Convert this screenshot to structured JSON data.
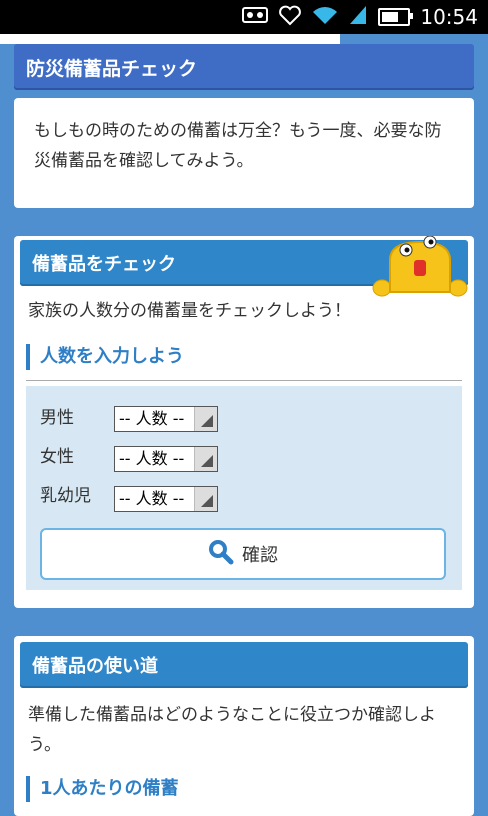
{
  "status_bar": {
    "time": "10:54"
  },
  "header_panel": {
    "title": "防災備蓄品チェック"
  },
  "intro_panel": {
    "text": "もしもの時のための備蓄は万全？もう一度、必要な防災備蓄品を確認してみよう。"
  },
  "check_panel": {
    "title": "備蓄品をチェック",
    "description": "家族の人数分の備蓄量をチェックしよう！",
    "subheading": "人数を入力しよう",
    "rows": [
      {
        "label": "男性",
        "selected": "-- 人数 --"
      },
      {
        "label": "女性",
        "selected": "-- 人数 --"
      },
      {
        "label": "乳幼児",
        "selected": "-- 人数 --"
      }
    ],
    "confirm_label": "確認"
  },
  "usage_panel": {
    "title": "備蓄品の使い道",
    "description": "準備した備蓄品はどのようなことに役立つか確認しよう。",
    "subheading": "1人あたりの備蓄"
  },
  "colors": {
    "page_bg": "#4f8fd0",
    "header_blue": "#3f6cc4",
    "section_blue": "#2f86c8",
    "form_bg": "#d7e8f4",
    "mascot_yellow": "#f6c31a"
  }
}
